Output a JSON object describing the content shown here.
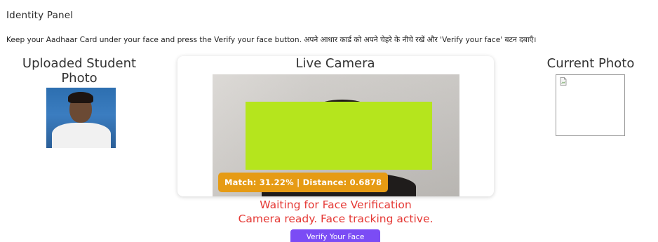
{
  "panel": {
    "title": "Identity Panel",
    "instructions": "Keep your Aadhaar Card under your face and press the Verify your face button. अपने आधार कार्ड को अपने चेहरे के नीचे रखें और 'Verify your face' बटन दबाएँ।"
  },
  "uploaded": {
    "heading": "Uploaded Student Photo"
  },
  "live_camera": {
    "heading": "Live Camera",
    "match_text": "Match: 31.22% | Distance: 0.6878",
    "face_box_color": "#b5e51d",
    "badge_color": "#e69b14"
  },
  "current_photo": {
    "heading": "Current Photo",
    "icon": "broken-image-icon"
  },
  "status": {
    "waiting": "Waiting for Face Verification",
    "camera": "Camera ready. Face tracking active.",
    "color": "#e53935"
  },
  "actions": {
    "verify_label": "Verify Your Face",
    "button_color": "#7b4cf5"
  }
}
